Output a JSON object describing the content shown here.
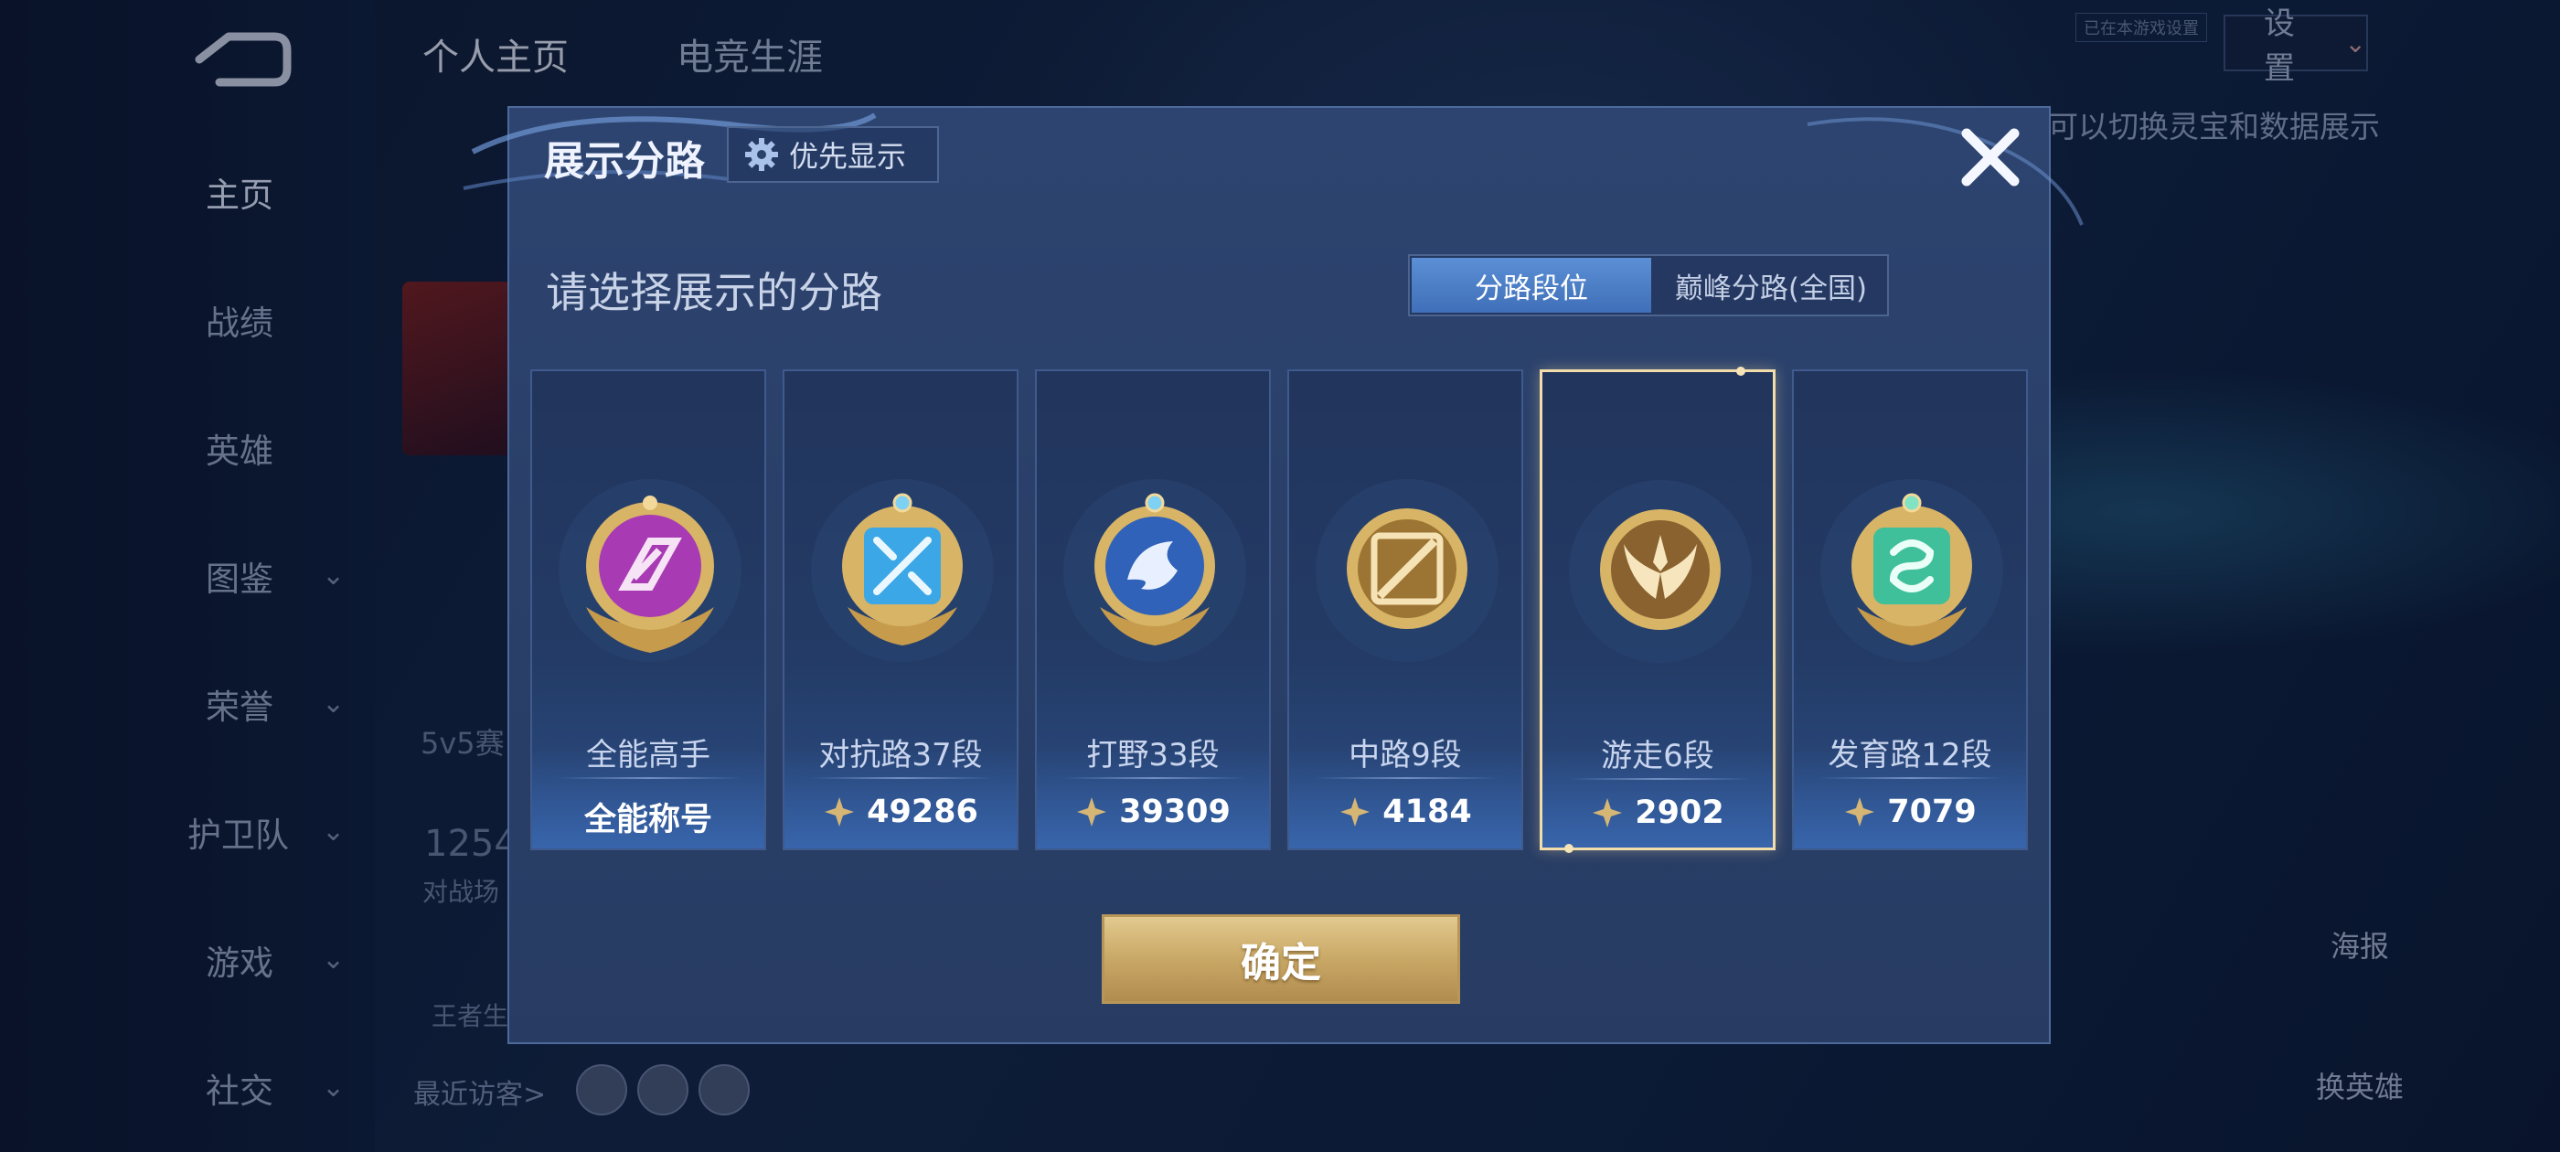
{
  "background": {
    "top_tabs": [
      "个人主页",
      "电竞生涯"
    ],
    "settings_label": "设置",
    "settings_badge": "已在本游戏设置",
    "hint_text": "可以切换灵宝和数据展示",
    "nav": [
      {
        "label": "主页",
        "active": true,
        "expandable": false
      },
      {
        "label": "战绩",
        "active": false,
        "expandable": false
      },
      {
        "label": "英雄",
        "active": false,
        "expandable": false
      },
      {
        "label": "图鉴",
        "active": false,
        "expandable": true
      },
      {
        "label": "荣誉",
        "active": false,
        "expandable": true
      },
      {
        "label": "护卫队",
        "active": false,
        "expandable": true
      },
      {
        "label": "游戏",
        "active": false,
        "expandable": true
      },
      {
        "label": "社交",
        "active": false,
        "expandable": true
      }
    ],
    "faint_texts": {
      "mode": "5v5赛",
      "count": "1254",
      "count_label": "对战场",
      "king_label": "王者生"
    },
    "recent_visitors_label": "最近访客>",
    "side_buttons": {
      "poster": "海报",
      "change_hero": "换英雄"
    }
  },
  "dialog": {
    "title": "展示分路",
    "priority_label": "优先显示",
    "subtitle": "请选择展示的分路",
    "toggle": {
      "active": "分路段位",
      "inactive": "巅峰分路(全国)"
    },
    "confirm_label": "确定",
    "cards": [
      {
        "name": "全能高手",
        "stat": "全能称号",
        "has_points_icon": false,
        "selected": false,
        "emblem_color": "#b03fb7",
        "emblem_icon": "all-round-emblem-icon"
      },
      {
        "name": "对抗路37段",
        "stat": "49286",
        "has_points_icon": true,
        "selected": false,
        "emblem_color": "#3ba7e6",
        "emblem_icon": "clash-lane-emblem-icon"
      },
      {
        "name": "打野33段",
        "stat": "39309",
        "has_points_icon": true,
        "selected": false,
        "emblem_color": "#2f62b8",
        "emblem_icon": "jungle-emblem-icon"
      },
      {
        "name": "中路9段",
        "stat": "4184",
        "has_points_icon": true,
        "selected": false,
        "emblem_color": "#c29a4e",
        "emblem_icon": "mid-lane-emblem-icon"
      },
      {
        "name": "游走6段",
        "stat": "2902",
        "has_points_icon": true,
        "selected": true,
        "emblem_color": "#b8894a",
        "emblem_icon": "roam-emblem-icon"
      },
      {
        "name": "发育路12段",
        "stat": "7079",
        "has_points_icon": true,
        "selected": false,
        "emblem_color": "#3fbf9a",
        "emblem_icon": "farm-lane-emblem-icon"
      }
    ]
  },
  "colors": {
    "accent_blue": "#4f83cc",
    "gold": "#d4b474",
    "selected_border": "#f2ddaa"
  }
}
